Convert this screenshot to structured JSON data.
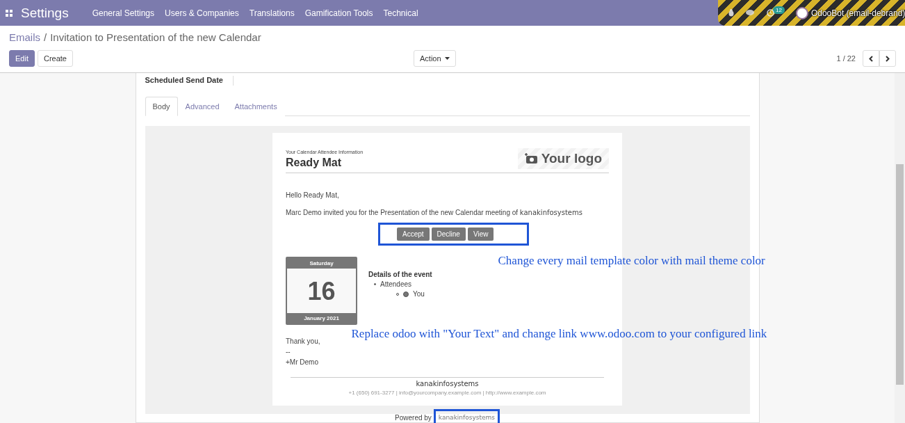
{
  "navbar": {
    "app_title": "Settings",
    "menu": [
      "General Settings",
      "Users & Companies",
      "Translations",
      "Gamification Tools",
      "Technical"
    ],
    "activity_count": "12",
    "user": "OdooBot (email-debrand)"
  },
  "breadcrumb": {
    "parent": "Emails",
    "separator": "/",
    "current": "Invitation to Presentation of the new Calendar"
  },
  "toolbar": {
    "edit": "Edit",
    "create": "Create",
    "action": "Action",
    "pager": "1 / 22"
  },
  "sheet": {
    "field_label": "Scheduled Send Date",
    "tabs": [
      {
        "label": "Body",
        "selected": true
      },
      {
        "label": "Advanced",
        "selected": false
      },
      {
        "label": "Attachments",
        "selected": false
      }
    ]
  },
  "email": {
    "subtitle": "Your Calendar Attendee Information",
    "name": "Ready Mat",
    "logo": "Your logo",
    "greeting": "Hello Ready Mat,",
    "invitation": "Marc Demo invited you for the Presentation of the new Calendar meeting of",
    "company": "kanakinfosystems",
    "actions": [
      "Accept",
      "Decline",
      "View"
    ],
    "calendar": {
      "weekday": "Saturday",
      "day": "16",
      "month": "January 2021"
    },
    "details_title": "Details of the event",
    "attendees_label": "Attendees",
    "attendee": "You",
    "signoff": [
      "Thank you,",
      "--",
      "+Mr Demo"
    ],
    "footer_company": "kanakinfosystems",
    "footer_contacts": "+1 (650) 691-3277 | info@yourcompany.example.com | http://www.example.com",
    "powered_by": "Powered by",
    "powered_company": "kanakinfosystems"
  },
  "annotations": [
    "Change every mail template color with mail theme color",
    "Replace odoo with \"Your Text\" and change link www.odoo.com to your configured link"
  ]
}
